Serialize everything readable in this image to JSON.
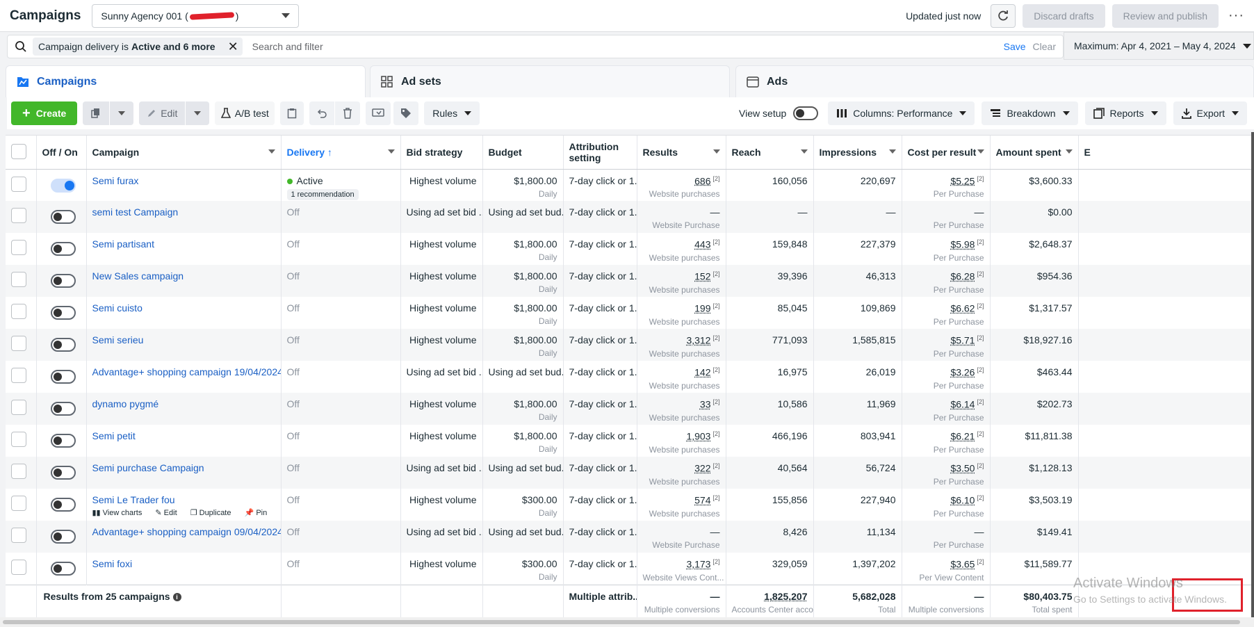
{
  "header": {
    "title": "Campaigns",
    "account_prefix": "Sunny Agency 001 (",
    "account_suffix": ")",
    "updated": "Updated just now",
    "discard": "Discard drafts",
    "review": "Review and publish",
    "more": "···"
  },
  "filter": {
    "chip_prefix": "Campaign delivery is",
    "chip_value": "Active and 6 more",
    "search_placeholder": "Search and filter",
    "save": "Save",
    "clear": "Clear",
    "date_range": "Maximum: Apr 4, 2021 – May 4, 2024"
  },
  "tabs": {
    "campaigns": "Campaigns",
    "adsets": "Ad sets",
    "ads": "Ads"
  },
  "toolbar": {
    "create": "Create",
    "edit": "Edit",
    "ab_test": "A/B test",
    "rules": "Rules",
    "view_setup": "View setup",
    "columns": "Columns: Performance",
    "breakdown": "Breakdown",
    "reports": "Reports",
    "export": "Export"
  },
  "columns": {
    "offon": "Off / On",
    "campaign": "Campaign",
    "delivery": "Delivery ↑",
    "bid": "Bid strategy",
    "budget": "Budget",
    "attr1": "Attribution",
    "attr2": "setting",
    "results": "Results",
    "reach": "Reach",
    "impressions": "Impressions",
    "cpr": "Cost per result",
    "spent": "Amount spent",
    "extra": "E"
  },
  "rows": [
    {
      "name": "Semi furax",
      "on": true,
      "delivery": "Active",
      "reco": "1 recommendation",
      "bid": "Highest volume",
      "budget": "$1,800.00",
      "budget_sub": "Daily",
      "attr": "7-day click or 1...",
      "results": "686",
      "results_sub": "Website purchases",
      "reach": "160,056",
      "impr": "220,697",
      "cpr": "$5.25",
      "cpr_sub": "Per Purchase",
      "spent": "$3,600.33"
    },
    {
      "name": "semi test Campaign",
      "on": false,
      "delivery": "Off",
      "bid": "Using ad set bid ...",
      "budget": "Using ad set bud...",
      "budget_sub": "",
      "attr": "7-day click or 1...",
      "results": "—",
      "results_sub": "Website Purchase",
      "reach": "—",
      "impr": "—",
      "cpr": "—",
      "cpr_sub": "Per Purchase",
      "spent": "$0.00"
    },
    {
      "name": "Semi partisant",
      "on": false,
      "delivery": "Off",
      "bid": "Highest volume",
      "budget": "$1,800.00",
      "budget_sub": "Daily",
      "attr": "7-day click or 1...",
      "results": "443",
      "results_sub": "Website purchases",
      "reach": "159,848",
      "impr": "227,379",
      "cpr": "$5.98",
      "cpr_sub": "Per Purchase",
      "spent": "$2,648.37"
    },
    {
      "name": "New Sales campaign",
      "on": false,
      "delivery": "Off",
      "bid": "Highest volume",
      "budget": "$1,800.00",
      "budget_sub": "Daily",
      "attr": "7-day click or 1...",
      "results": "152",
      "results_sub": "Website purchases",
      "reach": "39,396",
      "impr": "46,313",
      "cpr": "$6.28",
      "cpr_sub": "Per Purchase",
      "spent": "$954.36"
    },
    {
      "name": "Semi cuisto",
      "on": false,
      "delivery": "Off",
      "bid": "Highest volume",
      "budget": "$1,800.00",
      "budget_sub": "Daily",
      "attr": "7-day click or 1...",
      "results": "199",
      "results_sub": "Website purchases",
      "reach": "85,045",
      "impr": "109,869",
      "cpr": "$6.62",
      "cpr_sub": "Per Purchase",
      "spent": "$1,317.57"
    },
    {
      "name": "Semi serieu",
      "on": false,
      "delivery": "Off",
      "bid": "Highest volume",
      "budget": "$1,800.00",
      "budget_sub": "Daily",
      "attr": "7-day click or 1...",
      "results": "3,312",
      "results_sub": "Website purchases",
      "reach": "771,093",
      "impr": "1,585,815",
      "cpr": "$5.71",
      "cpr_sub": "Per Purchase",
      "spent": "$18,927.16"
    },
    {
      "name": "Advantage+ shopping campaign 19/04/2024 ...",
      "on": false,
      "delivery": "Off",
      "bid": "Using ad set bid ...",
      "budget": "Using ad set bud...",
      "budget_sub": "",
      "attr": "7-day click or 1...",
      "results": "142",
      "results_sub": "Website purchases",
      "reach": "16,975",
      "impr": "26,019",
      "cpr": "$3.26",
      "cpr_sub": "Per Purchase",
      "spent": "$463.44"
    },
    {
      "name": "dynamo pygmé",
      "on": false,
      "delivery": "Off",
      "bid": "Highest volume",
      "budget": "$1,800.00",
      "budget_sub": "Daily",
      "attr": "7-day click or 1...",
      "results": "33",
      "results_sub": "Website purchases",
      "reach": "10,586",
      "impr": "11,969",
      "cpr": "$6.14",
      "cpr_sub": "Per Purchase",
      "spent": "$202.73"
    },
    {
      "name": "Semi petit",
      "on": false,
      "delivery": "Off",
      "bid": "Highest volume",
      "budget": "$1,800.00",
      "budget_sub": "Daily",
      "attr": "7-day click or 1...",
      "results": "1,903",
      "results_sub": "Website purchases",
      "reach": "466,196",
      "impr": "803,941",
      "cpr": "$6.21",
      "cpr_sub": "Per Purchase",
      "spent": "$11,811.38"
    },
    {
      "name": "Semi purchase Campaign",
      "on": false,
      "delivery": "Off",
      "bid": "Using ad set bid ...",
      "budget": "Using ad set bud...",
      "budget_sub": "",
      "attr": "7-day click or 1...",
      "results": "322",
      "results_sub": "Website purchases",
      "reach": "40,564",
      "impr": "56,724",
      "cpr": "$3.50",
      "cpr_sub": "Per Purchase",
      "spent": "$1,128.13"
    },
    {
      "name": "Semi Le Trader fou",
      "on": false,
      "delivery": "Off",
      "bid": "Highest volume",
      "budget": "$300.00",
      "budget_sub": "Daily",
      "attr": "7-day click or 1...",
      "results": "574",
      "results_sub": "Website purchases",
      "reach": "155,856",
      "impr": "227,940",
      "cpr": "$6.10",
      "cpr_sub": "Per Purchase",
      "spent": "$3,503.19",
      "actions": [
        "View charts",
        "Edit",
        "Duplicate",
        "Pin"
      ]
    },
    {
      "name": "Advantage+ shopping campaign 09/04/2024 ...",
      "on": false,
      "delivery": "Off",
      "bid": "Using ad set bid ...",
      "budget": "Using ad set bud...",
      "budget_sub": "",
      "attr": "7-day click or 1...",
      "results": "—",
      "results_sub": "Website Purchase",
      "reach": "8,426",
      "impr": "11,134",
      "cpr": "—",
      "cpr_sub": "Per Purchase",
      "spent": "$149.41"
    },
    {
      "name": "Semi foxi",
      "on": false,
      "delivery": "Off",
      "bid": "Highest volume",
      "budget": "$300.00",
      "budget_sub": "Daily",
      "attr": "7-day click or 1...",
      "results": "3,173",
      "results_sub": "Website Views Cont...",
      "reach": "329,059",
      "impr": "1,397,202",
      "cpr": "$3.65",
      "cpr_sub": "Per View Content",
      "spent": "$11,589.77"
    }
  ],
  "footnote": "[2]",
  "total": {
    "label": "Results from 25 campaigns",
    "attr": "Multiple attrib...",
    "results": "—",
    "results_sub": "Multiple conversions",
    "reach": "1,825,207",
    "reach_sub": "Accounts Center acco...",
    "impr": "5,682,028",
    "impr_sub": "Total",
    "cpr": "—",
    "cpr_sub": "Multiple conversions",
    "spent": "$80,403.75",
    "spent_sub": "Total spent"
  },
  "watermark": {
    "line1": "Activate Windows",
    "line2": "Go to Settings to activate Windows."
  },
  "colors": {
    "accent": "#1877f2",
    "create_green": "#42b72a",
    "highlight_red": "#e0212b"
  }
}
